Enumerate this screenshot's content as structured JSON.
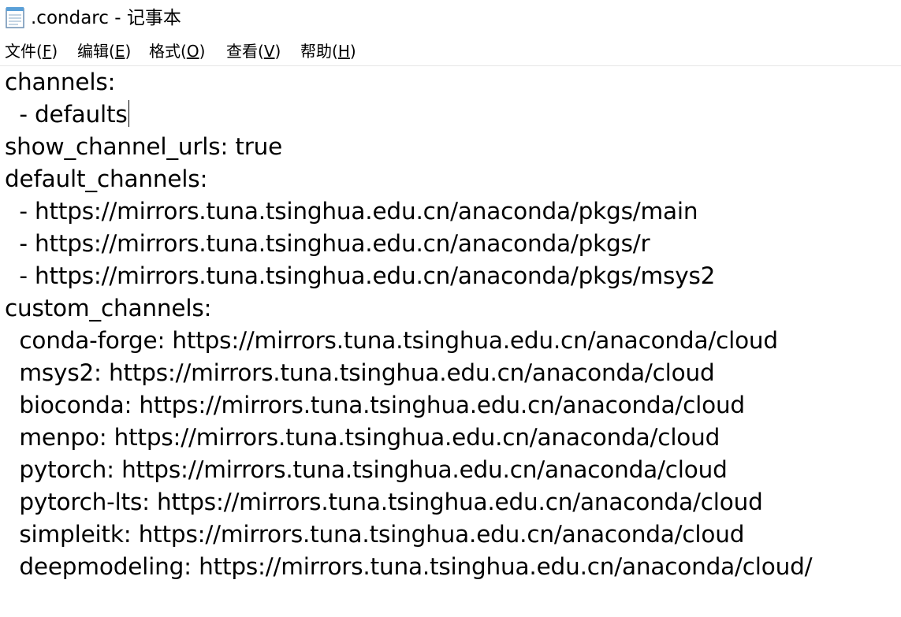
{
  "window": {
    "title": ".condarc - 记事本",
    "icon": "notepad-icon"
  },
  "menu": {
    "items": [
      {
        "label": "文件(",
        "key": "F",
        "suffix": ")"
      },
      {
        "label": "编辑(",
        "key": "E",
        "suffix": ")"
      },
      {
        "label": "格式(",
        "key": "O",
        "suffix": ")"
      },
      {
        "label": "查看(",
        "key": "V",
        "suffix": ")"
      },
      {
        "label": "帮助(",
        "key": "H",
        "suffix": ")"
      }
    ]
  },
  "editor": {
    "lines": [
      "channels:",
      "  - defaults",
      "show_channel_urls: true",
      "default_channels:",
      "  - https://mirrors.tuna.tsinghua.edu.cn/anaconda/pkgs/main",
      "  - https://mirrors.tuna.tsinghua.edu.cn/anaconda/pkgs/r",
      "  - https://mirrors.tuna.tsinghua.edu.cn/anaconda/pkgs/msys2",
      "custom_channels:",
      "  conda-forge: https://mirrors.tuna.tsinghua.edu.cn/anaconda/cloud",
      "  msys2: https://mirrors.tuna.tsinghua.edu.cn/anaconda/cloud",
      "  bioconda: https://mirrors.tuna.tsinghua.edu.cn/anaconda/cloud",
      "  menpo: https://mirrors.tuna.tsinghua.edu.cn/anaconda/cloud",
      "  pytorch: https://mirrors.tuna.tsinghua.edu.cn/anaconda/cloud",
      "  pytorch-lts: https://mirrors.tuna.tsinghua.edu.cn/anaconda/cloud",
      "  simpleitk: https://mirrors.tuna.tsinghua.edu.cn/anaconda/cloud",
      "  deepmodeling: https://mirrors.tuna.tsinghua.edu.cn/anaconda/cloud/"
    ]
  }
}
